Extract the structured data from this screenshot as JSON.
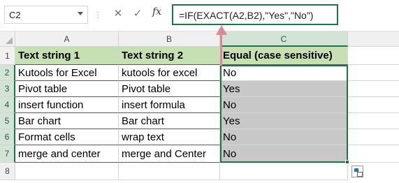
{
  "formula_bar": {
    "name_box": "C2",
    "separator": "⋮",
    "cancel_icon": "✕",
    "enter_icon": "✓",
    "fx_label": "fx",
    "formula": "=IF(EXACT(A2,B2),\"Yes\",\"No\")"
  },
  "grid": {
    "columns": [
      "A",
      "B",
      "C"
    ],
    "rows": [
      "1",
      "2",
      "3",
      "4",
      "5",
      "6",
      "7",
      "8"
    ],
    "headers": [
      "Text string 1",
      "Text string 2",
      "Equal (case sensitive)"
    ],
    "data": [
      [
        "Kutools for Excel",
        "kutools for excel",
        "No"
      ],
      [
        "Pivot table",
        "Pivot table",
        "Yes"
      ],
      [
        "insert function",
        "insert formula",
        "No"
      ],
      [
        "Bar chart",
        "Bar chart",
        "Yes"
      ],
      [
        "Format cells",
        "wrap text",
        "No"
      ],
      [
        "merge and center",
        "merge and Center",
        "No"
      ]
    ]
  },
  "colors": {
    "header_fill": "#c6e0b4",
    "selection": "#217346",
    "result_fill": "#c8c8c8",
    "arrow": "#d98c96"
  }
}
